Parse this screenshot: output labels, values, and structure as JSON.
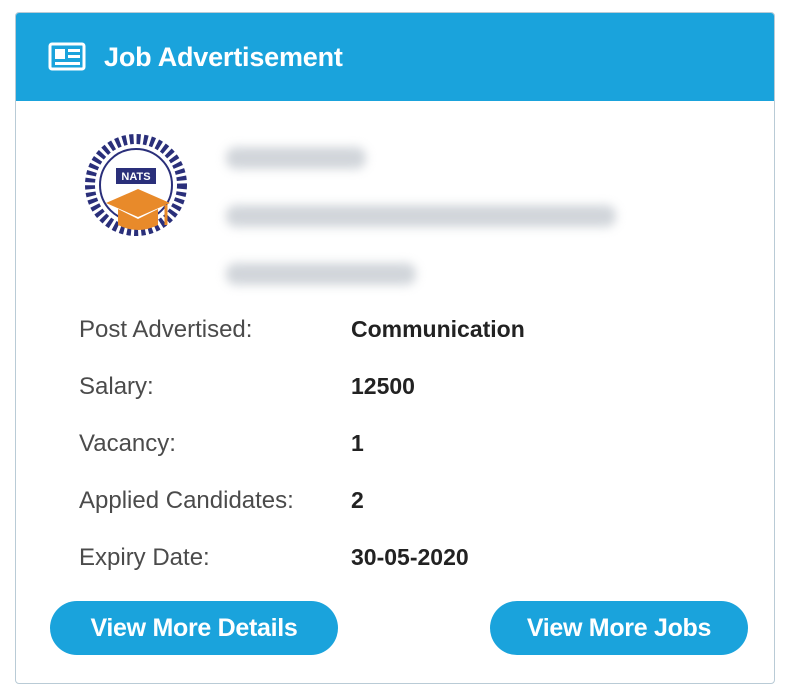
{
  "card": {
    "title": "Job Advertisement",
    "header_icon": "newspaper-icon",
    "accent_color": "#1aa3dc"
  },
  "company": {
    "logo_text": "NATS",
    "logo_icon": "graduation-cap-icon"
  },
  "details": [
    {
      "label": "Post Advertised:",
      "value": "Communication"
    },
    {
      "label": "Salary:",
      "value": "12500"
    },
    {
      "label": "Vacancy:",
      "value": "1"
    },
    {
      "label": "Applied Candidates:",
      "value": "2"
    },
    {
      "label": "Expiry Date:",
      "value": "30-05-2020"
    }
  ],
  "buttons": {
    "view_details": "View More Details",
    "view_jobs": "View More Jobs"
  }
}
